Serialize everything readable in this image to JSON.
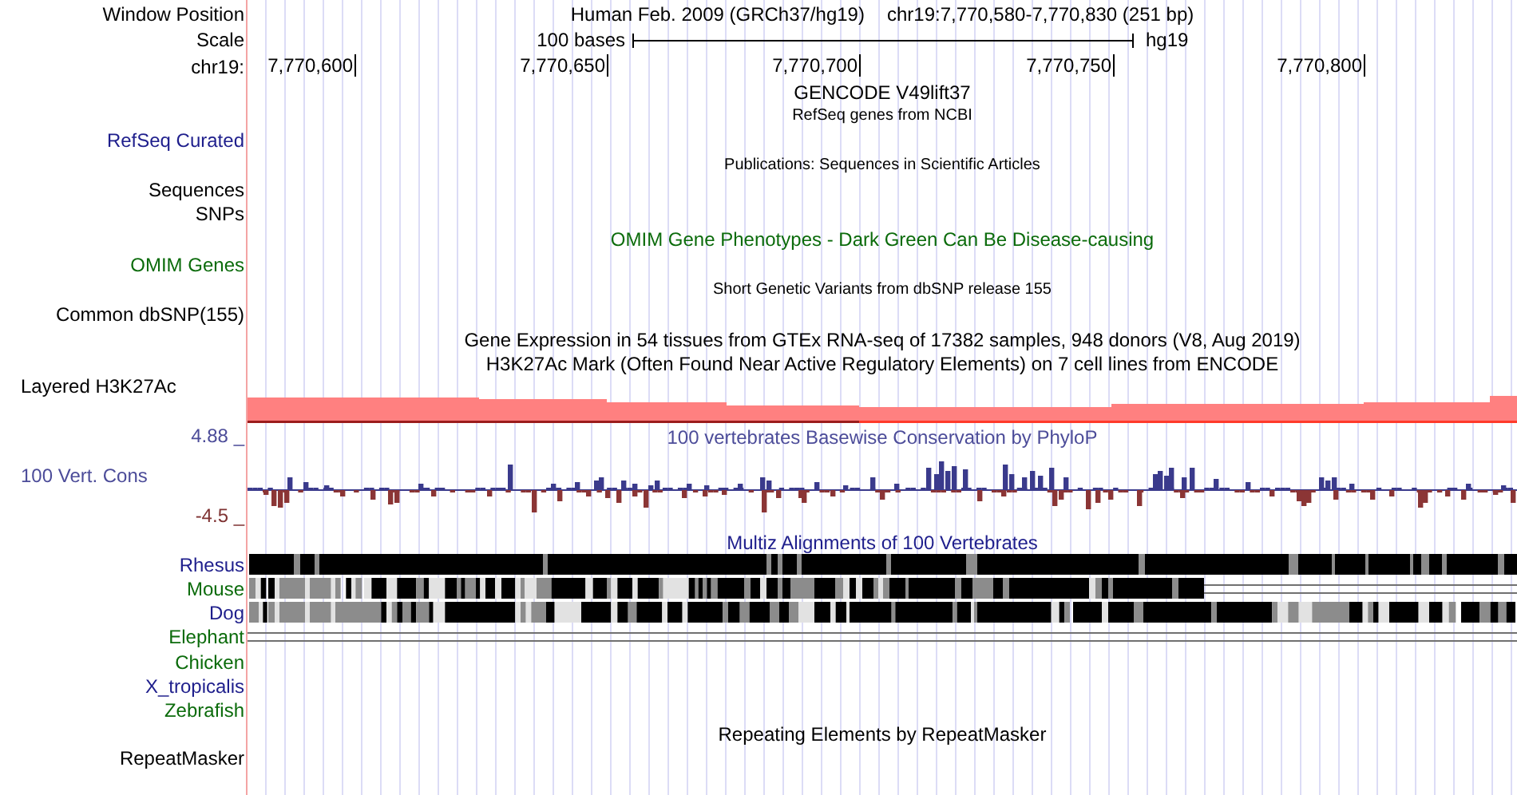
{
  "rows": [
    {
      "kind": "position",
      "label": "Window Position",
      "assembly": "Human Feb. 2009 (GRCh37/hg19)",
      "position": "chr19:7,770,580-7,770,830 (251 bp)"
    },
    {
      "kind": "scale",
      "label": "Scale",
      "bases": "100 bases",
      "assembly_name": "hg19"
    },
    {
      "kind": "ruler",
      "label": "chr19:",
      "ticks": [
        "7,770,600",
        "7,770,650",
        "7,770,700",
        "7,770,750",
        "7,770,800"
      ]
    },
    {
      "kind": "title",
      "text": "GENCODE V49lift37",
      "color": "#000000"
    },
    {
      "kind": "subtitle",
      "text": "RefSeq genes from NCBI"
    },
    {
      "kind": "label",
      "label": "RefSeq Curated",
      "color": "#1e1e8c"
    },
    {
      "kind": "subtitle",
      "text": "Publications: Sequences in Scientific Articles"
    },
    {
      "kind": "label",
      "label": "Sequences",
      "color": "#000000"
    },
    {
      "kind": "label",
      "label": "SNPs",
      "color": "#000000"
    },
    {
      "kind": "title",
      "text": "OMIM Gene Phenotypes - Dark Green Can Be Disease-causing",
      "color": "#0b6b0b"
    },
    {
      "kind": "label",
      "label": "OMIM Genes",
      "color": "#0b6b0b"
    },
    {
      "kind": "subtitle",
      "text": "Short Genetic Variants from dbSNP release 155"
    },
    {
      "kind": "label",
      "label": "Common dbSNP(155)",
      "color": "#000000"
    },
    {
      "kind": "title",
      "text": "Gene Expression in 54 tissues from GTEx RNA-seq of 17382 samples, 948 donors (V8, Aug 2019)",
      "color": "#000000"
    },
    {
      "kind": "title",
      "text": "H3K27Ac Mark (Often Found Near Active Regulatory Elements) on 7 cell lines from ENCODE",
      "color": "#000000"
    },
    {
      "kind": "layered",
      "label": "Layered H3K27Ac"
    },
    {
      "kind": "conservation",
      "label": "100 Vert. Cons",
      "max": "4.88 _",
      "min": "-4.5 _",
      "title": "100 vertebrates Basewise Conservation by PhyloP"
    },
    {
      "kind": "title",
      "text": "Multiz Alignments of 100 Vertebrates",
      "color": "#1e1e8c"
    },
    {
      "kind": "align",
      "label": "Rhesus",
      "color": "#1e1e8c"
    },
    {
      "kind": "align",
      "label": "Mouse",
      "color": "#0b6b0b"
    },
    {
      "kind": "align",
      "label": "Dog",
      "color": "#1e1e8c"
    },
    {
      "kind": "align",
      "label": "Elephant",
      "color": "#0b6b0b"
    },
    {
      "kind": "align",
      "label": "Chicken",
      "color": "#0b6b0b"
    },
    {
      "kind": "align",
      "label": "X_tropicalis",
      "color": "#1e1e8c"
    },
    {
      "kind": "align",
      "label": "Zebrafish",
      "color": "#0b6b0b"
    },
    {
      "kind": "title",
      "text": "Repeating Elements by RepeatMasker",
      "color": "#000000"
    },
    {
      "kind": "label",
      "label": "RepeatMasker",
      "color": "#000000"
    }
  ]
}
